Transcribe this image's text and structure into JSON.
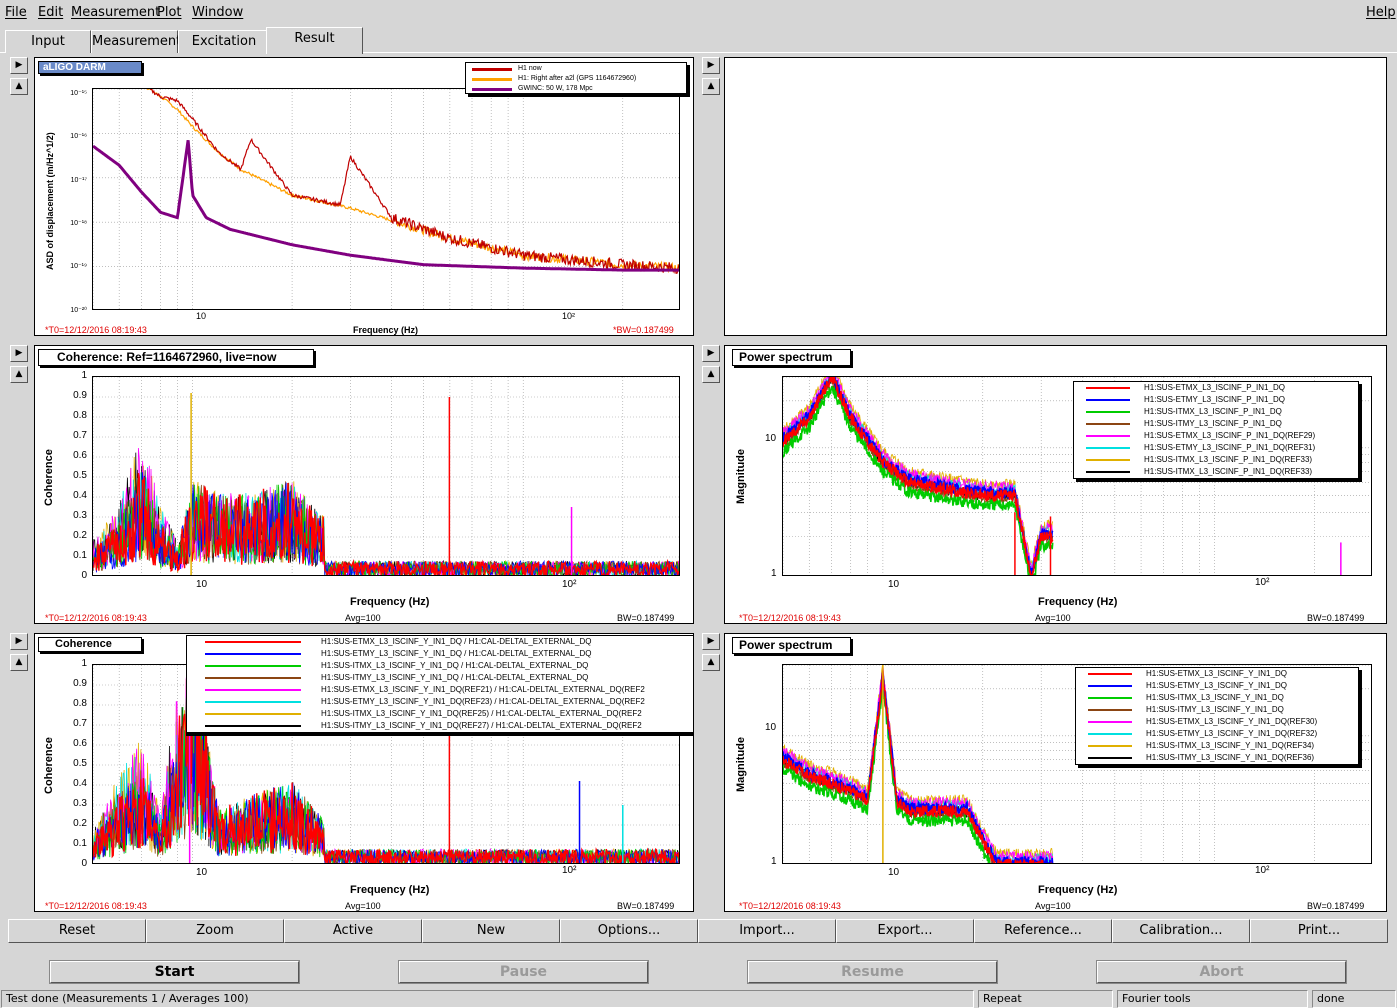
{
  "menu": {
    "file": "File",
    "edit": "Edit",
    "measurement": "Measurement",
    "plot": "Plot",
    "window": "Window",
    "help": "Help"
  },
  "tabs": {
    "input": "Input",
    "measurement": "Measurement",
    "excitation": "Excitation",
    "result": "Result"
  },
  "panel1": {
    "title": "aLIGO DARM",
    "ylabel": "ASD of displacement (m/Hz^1/2)",
    "xlabel": "Frequency (Hz)",
    "t0": "*T0=12/12/2016 08:19:43",
    "bw": "*BW=0.187499",
    "legend": [
      "H1 now",
      "H1: Right after a2l (GPS 1164672960)",
      "GWINC: 50 W, 178 Mpc"
    ],
    "yticks": [
      "10⁻¹⁵",
      "10⁻¹⁶",
      "10⁻¹⁷",
      "10⁻¹⁸",
      "10⁻¹⁹",
      "10⁻²⁰"
    ],
    "xticks": [
      "10",
      "10²"
    ]
  },
  "panel3": {
    "title": "Coherence: Ref=1164672960, live=now",
    "ylabel": "Coherence",
    "xlabel": "Frequency (Hz)",
    "t0": "*T0=12/12/2016 08:19:43",
    "avg": "Avg=100",
    "bw": "BW=0.187499",
    "yticks": [
      "1",
      "0.9",
      "0.8",
      "0.7",
      "0.6",
      "0.5",
      "0.4",
      "0.3",
      "0.2",
      "0.1",
      "0"
    ],
    "xticks": [
      "10",
      "10²"
    ]
  },
  "panel4": {
    "title": "Power spectrum",
    "ylabel": "Magnitude",
    "xlabel": "Frequency (Hz)",
    "t0": "*T0=12/12/2016 08:19:43",
    "avg": "Avg=100",
    "bw": "BW=0.187499",
    "yticks": [
      "10",
      "1"
    ],
    "xticks": [
      "10",
      "10²"
    ],
    "legend": [
      "H1:SUS-ETMX_L3_ISCINF_P_IN1_DQ",
      "H1:SUS-ETMY_L3_ISCINF_P_IN1_DQ",
      "H1:SUS-ITMX_L3_ISCINF_P_IN1_DQ",
      "H1:SUS-ITMY_L3_ISCINF_P_IN1_DQ",
      "H1:SUS-ETMX_L3_ISCINF_P_IN1_DQ(REF29)",
      "H1:SUS-ETMY_L3_ISCINF_P_IN1_DQ(REF31)",
      "H1:SUS-ITMX_L3_ISCINF_P_IN1_DQ(REF33)",
      "H1:SUS-ITMX_L3_ISCINF_P_IN1_DQ(REF33)"
    ]
  },
  "panel5": {
    "title": "Coherence",
    "ylabel": "Coherence",
    "xlabel": "Frequency (Hz)",
    "t0": "*T0=12/12/2016 08:19:43",
    "avg": "Avg=100",
    "bw": "BW=0.187499",
    "yticks": [
      "1",
      "0.9",
      "0.8",
      "0.7",
      "0.6",
      "0.5",
      "0.4",
      "0.3",
      "0.2",
      "0.1",
      "0"
    ],
    "xticks": [
      "10",
      "10²"
    ],
    "legend": [
      "H1:SUS-ETMX_L3_ISCINF_Y_IN1_DQ / H1:CAL-DELTAL_EXTERNAL_DQ",
      "H1:SUS-ETMY_L3_ISCINF_Y_IN1_DQ / H1:CAL-DELTAL_EXTERNAL_DQ",
      "H1:SUS-ITMX_L3_ISCINF_Y_IN1_DQ / H1:CAL-DELTAL_EXTERNAL_DQ",
      "H1:SUS-ITMY_L3_ISCINF_Y_IN1_DQ / H1:CAL-DELTAL_EXTERNAL_DQ",
      "H1:SUS-ETMX_L3_ISCINF_Y_IN1_DQ(REF21) / H1:CAL-DELTAL_EXTERNAL_DQ(REF2",
      "H1:SUS-ETMY_L3_ISCINF_Y_IN1_DQ(REF23) / H1:CAL-DELTAL_EXTERNAL_DQ(REF2",
      "H1:SUS-ITMX_L3_ISCINF_Y_IN1_DQ(REF25) / H1:CAL-DELTAL_EXTERNAL_DQ(REF2",
      "H1:SUS-ITMY_L3_ISCINF_Y_IN1_DQ(REF27) / H1:CAL-DELTAL_EXTERNAL_DQ(REF2"
    ]
  },
  "panel6": {
    "title": "Power spectrum",
    "ylabel": "Magnitude",
    "xlabel": "Frequency (Hz)",
    "t0": "*T0=12/12/2016 08:19:43",
    "avg": "Avg=100",
    "bw": "BW=0.187499",
    "yticks": [
      "10",
      "1"
    ],
    "xticks": [
      "10",
      "10²"
    ],
    "legend": [
      "H1:SUS-ETMX_L3_ISCINF_Y_IN1_DQ",
      "H1:SUS-ETMY_L3_ISCINF_Y_IN1_DQ",
      "H1:SUS-ITMX_L3_ISCINF_Y_IN1_DQ",
      "H1:SUS-ITMY_L3_ISCINF_Y_IN1_DQ",
      "H1:SUS-ETMX_L3_ISCINF_Y_IN1_DQ(REF30)",
      "H1:SUS-ETMY_L3_ISCINF_Y_IN1_DQ(REF32)",
      "H1:SUS-ITMX_L3_ISCINF_Y_IN1_DQ(REF34)",
      "H1:SUS-ITMY_L3_ISCINF_Y_IN1_DQ(REF36)"
    ]
  },
  "colors": {
    "asd_now": "#c00000",
    "asd_ref": "#ffa000",
    "gwinc": "#800080",
    "series": [
      "#ff0000",
      "#0000ff",
      "#00cc00",
      "#8b4513",
      "#ff00ff",
      "#00e0e0",
      "#e0b000",
      "#000000"
    ]
  },
  "toolbar": [
    "Reset",
    "Zoom",
    "Active",
    "New",
    "Options...",
    "Import...",
    "Export...",
    "Reference...",
    "Calibration...",
    "Print..."
  ],
  "actions": {
    "start": "Start",
    "pause": "Pause",
    "resume": "Resume",
    "abort": "Abort"
  },
  "status": {
    "message": "Test done (Measurements 1 / Averages 100)",
    "repeat": "Repeat",
    "fourier": "Fourier tools",
    "done": "done"
  },
  "chart_data": [
    {
      "type": "line",
      "title": "aLIGO DARM",
      "xlabel": "Frequency (Hz)",
      "ylabel": "ASD of displacement (m/Hz^1/2)",
      "xscale": "log",
      "yscale": "log",
      "xlim": [
        5,
        300
      ],
      "ylim": [
        1e-20,
        1.5e-15
      ],
      "series": [
        {
          "name": "H1 now",
          "x": [
            7,
            8,
            9,
            10,
            12,
            14,
            15,
            20,
            28,
            30,
            40,
            60,
            100,
            200,
            300
          ],
          "y": [
            2e-15,
            1e-15,
            8e-16,
            3e-16,
            5e-17,
            2e-17,
            1e-16,
            5e-18,
            3e-18,
            4e-17,
            1.5e-18,
            5e-19,
            2e-19,
            1.2e-19,
            1e-19
          ]
        },
        {
          "name": "H1: Right after a2l (GPS 1164672960)",
          "x": [
            7,
            8,
            9,
            10,
            12,
            14,
            20,
            30,
            40,
            60,
            100,
            200,
            300
          ],
          "y": [
            2e-15,
            1e-15,
            5e-16,
            2e-16,
            5e-17,
            2e-17,
            5e-18,
            2.5e-18,
            1.3e-18,
            5e-19,
            2e-19,
            1.2e-19,
            1e-19
          ]
        },
        {
          "name": "GWINC: 50 W, 178 Mpc",
          "x": [
            5,
            6,
            7,
            8,
            9,
            9.7,
            10,
            11,
            13,
            20,
            30,
            50,
            100,
            200,
            300
          ],
          "y": [
            7e-17,
            2.5e-17,
            6e-18,
            2e-18,
            1.5e-18,
            1e-16,
            5e-18,
            1.5e-18,
            8e-19,
            3.5e-19,
            2e-19,
            1.2e-19,
            1e-19,
            9e-20,
            9e-20
          ]
        }
      ]
    },
    {
      "type": "line",
      "title": "Coherence: Ref=1164672960, live=now",
      "xlabel": "Frequency (Hz)",
      "ylabel": "Coherence",
      "xscale": "log",
      "xlim": [
        5,
        300
      ],
      "ylim": [
        0,
        1
      ],
      "series": [
        {
          "x": [
            5,
            6,
            7,
            8,
            9,
            10,
            12,
            15,
            20,
            30,
            60,
            100,
            300
          ],
          "y": [
            0.1,
            0.2,
            0.4,
            0.2,
            0.1,
            0.35,
            0.3,
            0.3,
            0.35,
            0.1,
            0.9,
            0.05,
            0.92
          ]
        }
      ]
    },
    {
      "type": "line",
      "title": "Power spectrum",
      "xlabel": "Frequency (Hz)",
      "ylabel": "Magnitude",
      "xscale": "log",
      "yscale": "log",
      "xlim": [
        5,
        300
      ],
      "ylim": [
        1,
        30
      ],
      "series": [
        {
          "name": "H1:SUS-ETMX_L3_ISCINF_P_IN1_DQ",
          "x": [
            5,
            6,
            7,
            8,
            10,
            12,
            15,
            20,
            25,
            28,
            30
          ],
          "y": [
            10,
            15,
            30,
            15,
            7,
            5,
            4.5,
            4,
            4,
            1,
            2
          ]
        }
      ]
    },
    {
      "type": "line",
      "title": "Coherence",
      "xlabel": "Frequency (Hz)",
      "ylabel": "Coherence",
      "xscale": "log",
      "xlim": [
        5,
        300
      ],
      "ylim": [
        0,
        1
      ],
      "series": [
        {
          "x": [
            5,
            6,
            7,
            8,
            10,
            12,
            15,
            20,
            30,
            60,
            100,
            300
          ],
          "y": [
            0.1,
            0.25,
            0.35,
            0.15,
            0.8,
            0.2,
            0.25,
            0.3,
            0.05,
            0.85,
            0.05,
            0.05
          ]
        }
      ]
    },
    {
      "type": "line",
      "title": "Power spectrum",
      "xlabel": "Frequency (Hz)",
      "ylabel": "Magnitude",
      "xscale": "log",
      "yscale": "log",
      "xlim": [
        5,
        300
      ],
      "ylim": [
        1,
        30
      ],
      "series": [
        {
          "name": "H1:SUS-ETMY_L3_ISCINF_Y_IN1_DQ",
          "x": [
            5,
            6,
            7,
            8,
            9,
            10,
            11,
            12,
            15,
            18,
            20,
            22
          ],
          "y": [
            6,
            4.5,
            4,
            3.5,
            3,
            25,
            3,
            2.5,
            2.5,
            2.5,
            1.5,
            1
          ]
        }
      ]
    }
  ]
}
